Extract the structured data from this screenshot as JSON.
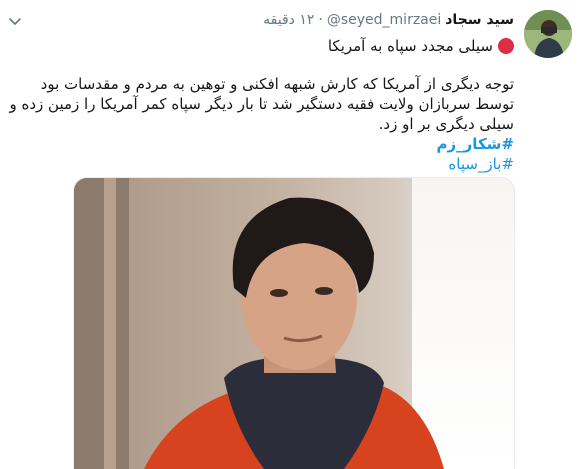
{
  "tweet": {
    "display_name": "سید سجاد",
    "handle": "@seyed_mirzaei",
    "separator": "·",
    "time": "۱۲ دقیقه",
    "title": "سیلی مجدد سپاه به آمریکا",
    "body": "توجه دیگری از آمریکا که کارش شبهه افکنی و توهین به مردم و مقدسات بود توسط سربازان ولایت فقیه دستگیر شد تا بار دیگر سپاه کمر آمریکا را زمین زده و سیلی دیگری بر او زد.",
    "hashtags": [
      "#شکار_زم",
      "#باز_سپاه"
    ]
  },
  "icons": {
    "avatar": "profile-avatar",
    "menu": "chevron-down-icon",
    "title_marker": "red-circle-icon"
  },
  "colors": {
    "link": "#1b95e0",
    "red_circle": "#dd2e44",
    "secondary_text": "#657786"
  }
}
